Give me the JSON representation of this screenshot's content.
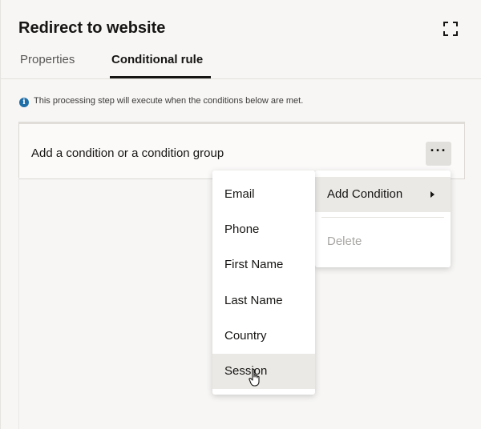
{
  "header": {
    "title": "Redirect to website",
    "expand_icon": "expand-icon"
  },
  "tabs": [
    {
      "label": "Properties",
      "active": false
    },
    {
      "label": "Conditional rule",
      "active": true
    }
  ],
  "info": {
    "icon": "info-icon",
    "text": "This processing step will execute when the conditions below are met."
  },
  "condition_box": {
    "label": "Add a condition or a condition group",
    "more_icon": "more-options-icon",
    "more_label": "···"
  },
  "actions_menu": {
    "items": [
      {
        "label": "Add Condition",
        "has_submenu": true,
        "active": true
      },
      {
        "label": "Delete",
        "disabled": true
      }
    ]
  },
  "condition_submenu": {
    "items": [
      {
        "label": "Email"
      },
      {
        "label": "Phone"
      },
      {
        "label": "First Name"
      },
      {
        "label": "Last Name"
      },
      {
        "label": "Country"
      },
      {
        "label": "Session",
        "hovered": true
      }
    ]
  },
  "colors": {
    "panel_bg": "#f7f6f4",
    "info_blue": "#1f6ea8",
    "hover_bg": "#ebe9e6",
    "text": "#161513"
  }
}
